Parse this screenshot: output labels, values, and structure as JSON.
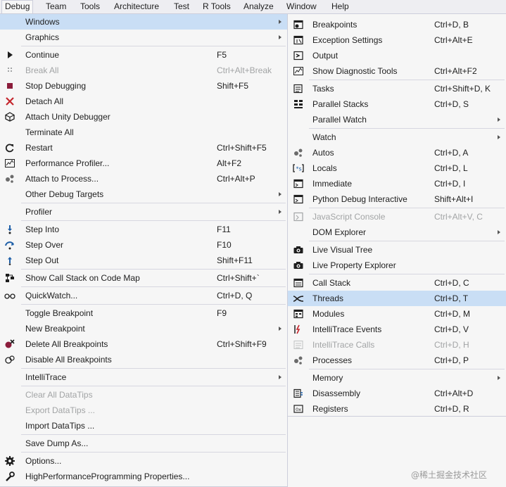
{
  "menubar": [
    "Debug",
    "Team",
    "Tools",
    "Architecture",
    "Test",
    "R Tools",
    "Analyze",
    "Window",
    "Help"
  ],
  "main_menu": [
    {
      "label": "Windows",
      "shortcut": "",
      "submenu": true,
      "highlight": true,
      "icon": ""
    },
    {
      "label": "Graphics",
      "shortcut": "",
      "submenu": true,
      "icon": ""
    },
    {
      "label": "Continue",
      "shortcut": "F5",
      "icon": "play-icon"
    },
    {
      "label": "Break All",
      "shortcut": "Ctrl+Alt+Break",
      "disabled": true,
      "icon": "pause-icon"
    },
    {
      "label": "Stop Debugging",
      "shortcut": "Shift+F5",
      "icon": "stop-icon"
    },
    {
      "label": "Detach All",
      "shortcut": "",
      "icon": "detach-icon"
    },
    {
      "label": "Attach Unity Debugger",
      "shortcut": "",
      "icon": "unity-icon"
    },
    {
      "label": "Terminate All",
      "shortcut": "",
      "icon": ""
    },
    {
      "label": "Restart",
      "shortcut": "Ctrl+Shift+F5",
      "icon": "restart-icon"
    },
    {
      "label": "Performance Profiler...",
      "shortcut": "Alt+F2",
      "icon": "profiler-icon"
    },
    {
      "label": "Attach to Process...",
      "shortcut": "Ctrl+Alt+P",
      "icon": "attach-process-icon"
    },
    {
      "label": "Other Debug Targets",
      "shortcut": "",
      "submenu": true,
      "icon": ""
    },
    {
      "label": "Profiler",
      "shortcut": "",
      "submenu": true,
      "icon": ""
    },
    {
      "label": "Step Into",
      "shortcut": "F11",
      "icon": "step-into-icon"
    },
    {
      "label": "Step Over",
      "shortcut": "F10",
      "icon": "step-over-icon"
    },
    {
      "label": "Step Out",
      "shortcut": "Shift+F11",
      "icon": "step-out-icon"
    },
    {
      "label": "Show Call Stack on Code Map",
      "shortcut": "Ctrl+Shift+`",
      "icon": "code-map-icon"
    },
    {
      "label": "QuickWatch...",
      "shortcut": "Ctrl+D, Q",
      "icon": "glasses-icon"
    },
    {
      "label": "Toggle Breakpoint",
      "shortcut": "F9",
      "icon": ""
    },
    {
      "label": "New Breakpoint",
      "shortcut": "",
      "submenu": true,
      "icon": ""
    },
    {
      "label": "Delete All Breakpoints",
      "shortcut": "Ctrl+Shift+F9",
      "icon": "delete-breakpoints-icon"
    },
    {
      "label": "Disable All Breakpoints",
      "shortcut": "",
      "icon": "disable-breakpoints-icon"
    },
    {
      "label": "IntelliTrace",
      "shortcut": "",
      "submenu": true,
      "icon": ""
    },
    {
      "label": "Clear All DataTips",
      "shortcut": "",
      "disabled": true,
      "icon": ""
    },
    {
      "label": "Export DataTips ...",
      "shortcut": "",
      "disabled": true,
      "icon": ""
    },
    {
      "label": "Import DataTips ...",
      "shortcut": "",
      "icon": ""
    },
    {
      "label": "Save Dump As...",
      "shortcut": "",
      "icon": ""
    },
    {
      "label": "Options...",
      "shortcut": "",
      "icon": "gear-icon"
    },
    {
      "label": "HighPerformanceProgramming Properties...",
      "shortcut": "",
      "icon": "wrench-icon"
    }
  ],
  "sub_menu": [
    {
      "label": "Breakpoints",
      "shortcut": "Ctrl+D, B",
      "icon": "breakpoints-window-icon"
    },
    {
      "label": "Exception Settings",
      "shortcut": "Ctrl+Alt+E",
      "icon": "exception-icon"
    },
    {
      "label": "Output",
      "shortcut": "",
      "icon": "output-icon"
    },
    {
      "label": "Show Diagnostic Tools",
      "shortcut": "Ctrl+Alt+F2",
      "icon": "diagnostic-icon"
    },
    {
      "label": "Tasks",
      "shortcut": "Ctrl+Shift+D, K",
      "icon": "tasks-icon"
    },
    {
      "label": "Parallel Stacks",
      "shortcut": "Ctrl+D, S",
      "icon": "parallel-stacks-icon"
    },
    {
      "label": "Parallel Watch",
      "shortcut": "",
      "submenu": true,
      "icon": ""
    },
    {
      "label": "Watch",
      "shortcut": "",
      "submenu": true,
      "icon": ""
    },
    {
      "label": "Autos",
      "shortcut": "Ctrl+D, A",
      "icon": "autos-icon"
    },
    {
      "label": "Locals",
      "shortcut": "Ctrl+D, L",
      "icon": "locals-icon"
    },
    {
      "label": "Immediate",
      "shortcut": "Ctrl+D, I",
      "icon": "immediate-icon"
    },
    {
      "label": "Python Debug Interactive",
      "shortcut": "Shift+Alt+I",
      "icon": "python-icon"
    },
    {
      "label": "JavaScript Console",
      "shortcut": "Ctrl+Alt+V, C",
      "disabled": true,
      "icon": "js-console-icon"
    },
    {
      "label": "DOM Explorer",
      "shortcut": "",
      "submenu": true,
      "icon": ""
    },
    {
      "label": "Live Visual Tree",
      "shortcut": "",
      "icon": "camera-icon"
    },
    {
      "label": "Live Property Explorer",
      "shortcut": "",
      "icon": "camera-icon"
    },
    {
      "label": "Call Stack",
      "shortcut": "Ctrl+D, C",
      "icon": "call-stack-icon"
    },
    {
      "label": "Threads",
      "shortcut": "Ctrl+D, T",
      "highlight": true,
      "icon": "threads-icon"
    },
    {
      "label": "Modules",
      "shortcut": "Ctrl+D, M",
      "icon": "modules-icon"
    },
    {
      "label": "IntelliTrace Events",
      "shortcut": "Ctrl+D, V",
      "icon": "intellitrace-events-icon"
    },
    {
      "label": "IntelliTrace Calls",
      "shortcut": "Ctrl+D, H",
      "disabled": true,
      "icon": "intellitrace-calls-icon"
    },
    {
      "label": "Processes",
      "shortcut": "Ctrl+D, P",
      "icon": "processes-icon"
    },
    {
      "label": "Memory",
      "shortcut": "",
      "submenu": true,
      "icon": ""
    },
    {
      "label": "Disassembly",
      "shortcut": "Ctrl+Alt+D",
      "icon": "disassembly-icon"
    },
    {
      "label": "Registers",
      "shortcut": "Ctrl+D, R",
      "icon": "registers-icon"
    }
  ],
  "watermark": "@稀土掘金技术社区"
}
